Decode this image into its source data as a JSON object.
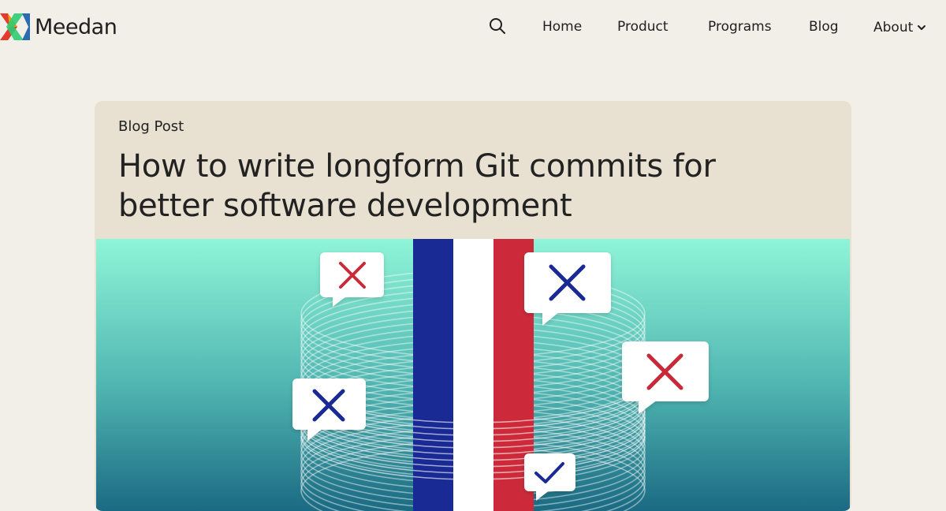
{
  "brand": {
    "name": "Meedan",
    "logo_colors": [
      "#e23b2e",
      "#f39c12",
      "#2ecc71",
      "#2b6cb0"
    ]
  },
  "nav": {
    "search_icon": "search-icon",
    "items": [
      "Home",
      "Product",
      "Programs",
      "Blog",
      "About"
    ],
    "about_icon": "chevron-down-icon"
  },
  "post": {
    "eyebrow": "Blog Post",
    "title": "How to write longform Git commits for better software development"
  },
  "hero": {
    "background_top": "#8ff5d8",
    "background_bottom": "#1b6a83",
    "flag_colors": [
      "#1a2a94",
      "#ffffff",
      "#cc2a3a"
    ],
    "bubbles": [
      {
        "icon": "x-mark-icon",
        "color": "#c92a3a"
      },
      {
        "icon": "x-mark-icon",
        "color": "#1a2a94"
      },
      {
        "icon": "x-mark-icon",
        "color": "#c92a3a"
      },
      {
        "icon": "x-mark-icon",
        "color": "#1a2a94"
      },
      {
        "icon": "check-mark-icon",
        "color": "#1a2a94"
      }
    ]
  }
}
